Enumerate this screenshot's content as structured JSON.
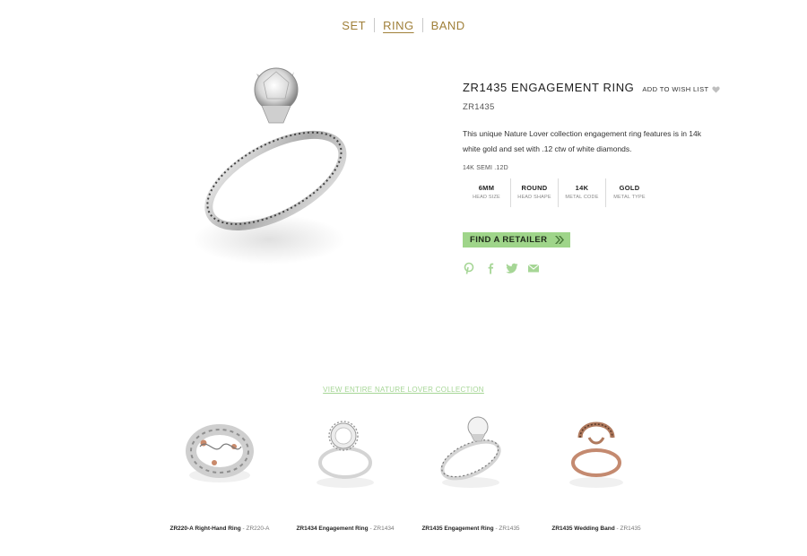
{
  "tabs": [
    {
      "label": "SET",
      "active": false
    },
    {
      "label": "RING",
      "active": true
    },
    {
      "label": "BAND",
      "active": false
    }
  ],
  "product": {
    "title": "ZR1435 ENGAGEMENT RING",
    "wishlist_label": "ADD TO WISH LIST",
    "sku": "ZR1435",
    "description": "This unique Nature Lover collection engagement ring features is in 14k white gold and set with .12 ctw of white diamonds.",
    "spec_code": "14K SEMI .12D",
    "image_icon": "ring-image"
  },
  "specs": [
    {
      "value": "6MM",
      "label": "HEAD SIZE"
    },
    {
      "value": "ROUND",
      "label": "HEAD SHAPE"
    },
    {
      "value": "14K",
      "label": "METAL CODE"
    },
    {
      "value": "GOLD",
      "label": "METAL TYPE"
    }
  ],
  "retailer_button": {
    "label": "FIND A RETAILER",
    "icon": "chevron-right-icon"
  },
  "social": [
    "pinterest-icon",
    "facebook-icon",
    "twitter-icon",
    "email-icon"
  ],
  "collection_link": "VIEW ENTIRE NATURE LOVER COLLECTION",
  "related": [
    {
      "name": "ZR220-A Right-Hand Ring",
      "code": "ZR220-A"
    },
    {
      "name": "ZR1434 Engagement Ring",
      "code": "ZR1434"
    },
    {
      "name": "ZR1435 Engagement Ring",
      "code": "ZR1435"
    },
    {
      "name": "ZR1435 Wedding Band",
      "code": "ZR1435"
    }
  ],
  "colors": {
    "tab_gold": "#a0803a",
    "accent_green": "#9fd58a",
    "link_green": "#a6d696"
  }
}
